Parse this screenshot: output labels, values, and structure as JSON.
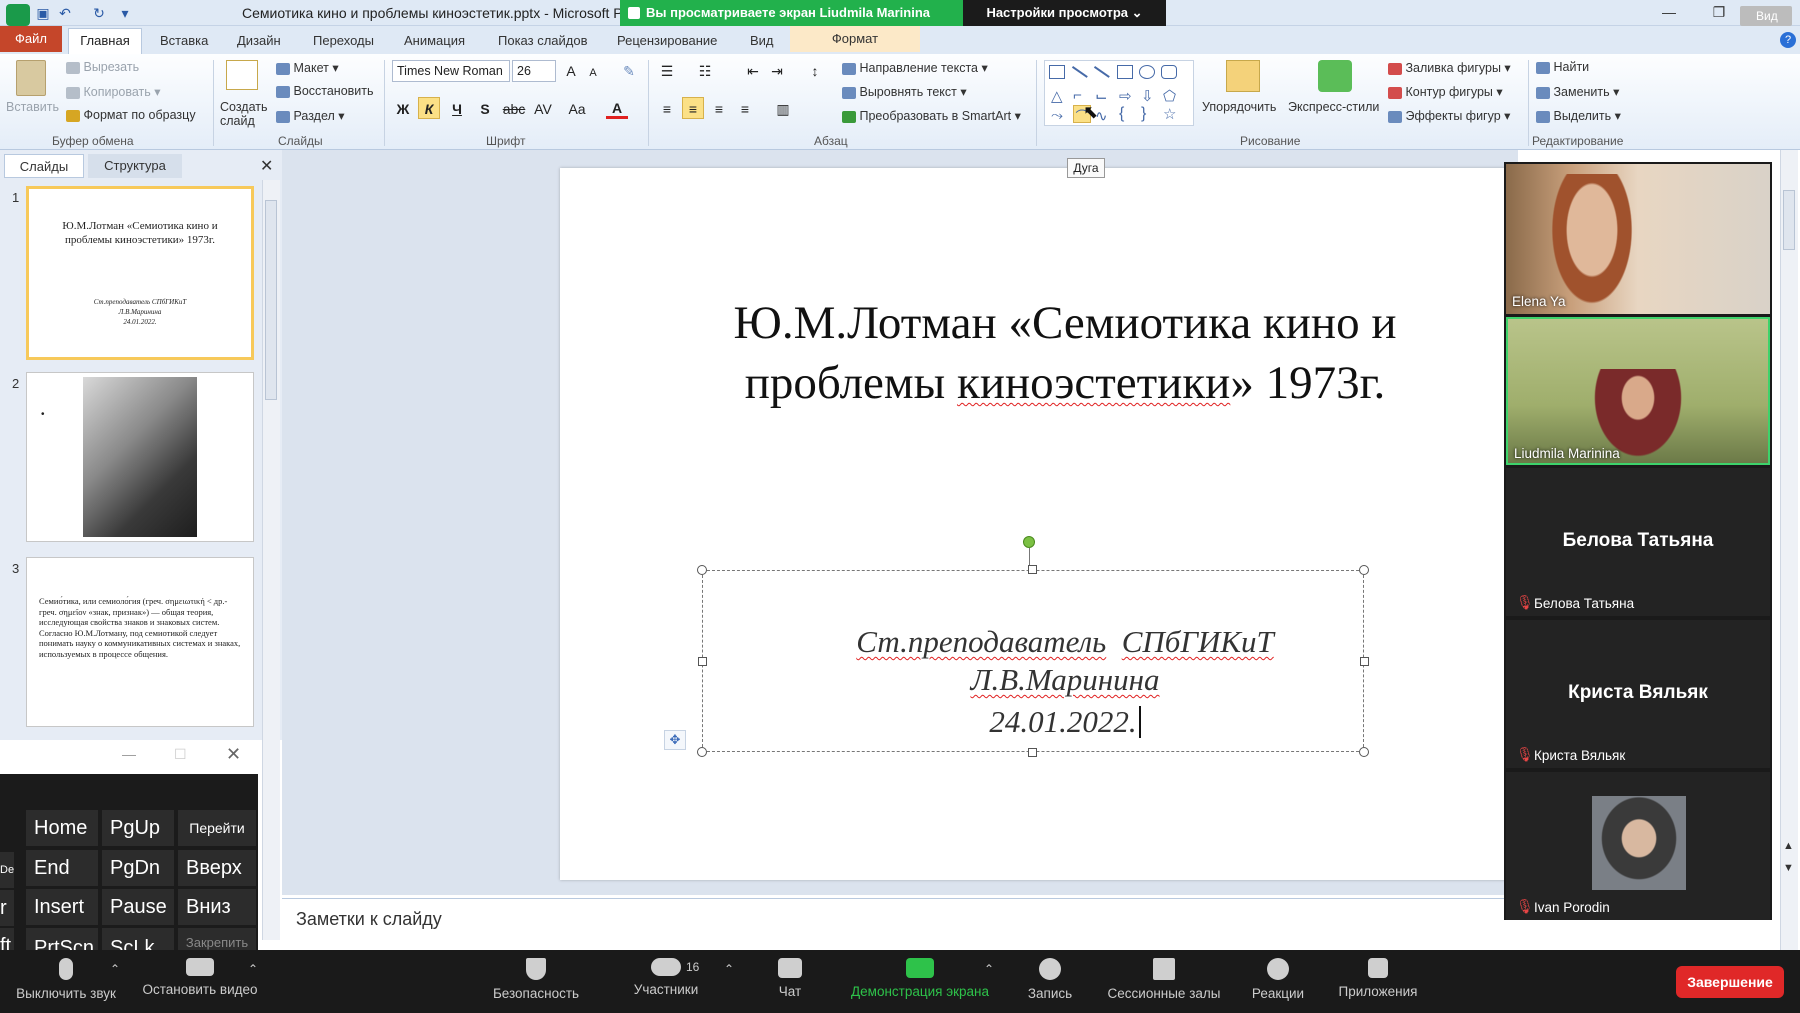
{
  "titlebar": {
    "document_title": "Семиотика кино и проблемы киноэстетик.pptx - Microsoft P",
    "share_banner": "Вы просматриваете экран Liudmila Marinina",
    "view_options": "Настройки просмотра ⌄",
    "view_button": "Вид"
  },
  "ribbon_tabs": {
    "file": "Файл",
    "home": "Главная",
    "insert": "Вставка",
    "design": "Дизайн",
    "transitions": "Переходы",
    "animation": "Анимация",
    "slideshow": "Показ слайдов",
    "review": "Рецензирование",
    "view": "Вид",
    "format": "Формат"
  },
  "ribbon": {
    "clipboard": {
      "paste": "Вставить",
      "cut": "Вырезать",
      "copy": "Копировать",
      "format_painter": "Формат по образцу",
      "label": "Буфер обмена"
    },
    "slides": {
      "new_slide": "Создать слайд",
      "layout": "Макет",
      "reset": "Восстановить",
      "section": "Раздел",
      "label": "Слайды"
    },
    "font": {
      "name": "Times New Roman",
      "size": "26",
      "bold": "Ж",
      "italic": "К",
      "underline": "Ч",
      "shadow": "S",
      "strike": "abc",
      "spacing": "AV",
      "case": "Aa",
      "color": "A",
      "grow": "A",
      "shrink": "A",
      "label": "Шрифт"
    },
    "paragraph": {
      "text_direction": "Направление текста",
      "align_text": "Выровнять текст",
      "smartart": "Преобразовать в SmartArt",
      "label": "Абзац"
    },
    "drawing": {
      "arrange": "Упорядочить",
      "quick_styles": "Экспресс-стили",
      "fill": "Заливка фигуры",
      "outline": "Контур фигуры",
      "effects": "Эффекты фигур",
      "label": "Рисование"
    },
    "editing": {
      "find": "Найти",
      "replace": "Заменить",
      "select": "Выделить",
      "label": "Редактирование"
    }
  },
  "tooltip": "Дуга",
  "left_panel": {
    "tab_slides": "Слайды",
    "tab_outline": "Структура",
    "thumbs": [
      {
        "num": "1",
        "title": "Ю.М.Лотман «Семиотика кино и проблемы киноэстетики» 1973г.",
        "sub1": "Ст.преподаватель СПбГИКиТ",
        "sub2": "Л.В.Маринина",
        "sub3": "24.01.2022."
      },
      {
        "num": "2",
        "bullet": "•"
      },
      {
        "num": "3",
        "text": "Семио́тика, или семиоло́гия (греч. σημειωτική < др.-греч. σημεῖον «знак, признак») — общая теория, исследующая свойства знаков и знаковых систем. Согласно Ю.М.Лотману, под семиотикой следует понимать науку о коммуникативных системах и знаках, используемых в процессе общения."
      }
    ]
  },
  "slide": {
    "title_line1": "Ю.М.Лотман «Семиотика кино и",
    "title_line2_a": "проблемы ",
    "title_line2_b": "киноэстетики",
    "title_line2_c": "»  1973г.",
    "sub_line1_a": "Ст.преподаватель",
    "sub_line1_b": "СПбГИКиТ",
    "sub_line2": "Л.В.Маринина",
    "sub_line3": "24.01.2022."
  },
  "notes_placeholder": "Заметки к слайду",
  "keyboard": {
    "keys": [
      "Home",
      "PgUp",
      "Перейти",
      "End",
      "PgDn",
      "Вверх",
      "Insert",
      "Pause",
      "Вниз",
      "PrtScn",
      "ScLk",
      "Закрепить"
    ],
    "edge_keys": [
      "Del",
      "r",
      "ft"
    ]
  },
  "participants": [
    {
      "name": "Elena Ya"
    },
    {
      "name": "Liudmila Marinina"
    },
    {
      "name": "Белова Татьяна"
    },
    {
      "name": "Криста Вяльяк"
    },
    {
      "name": "Ivan Porodin"
    }
  ],
  "zoom_toolbar": {
    "mute": "Выключить звук",
    "stop_video": "Остановить видео",
    "security": "Безопасность",
    "participants": "Участники",
    "participants_count": "16",
    "chat": "Чат",
    "share": "Демонстрация экрана",
    "record": "Запись",
    "breakout": "Сессионные залы",
    "reactions": "Реакции",
    "apps": "Приложения",
    "end": "Завершение"
  },
  "colors": {
    "share_green": "#22b14c",
    "end_red": "#e02828",
    "file_tab": "#c5462a",
    "active_green": "#2ec24a"
  }
}
